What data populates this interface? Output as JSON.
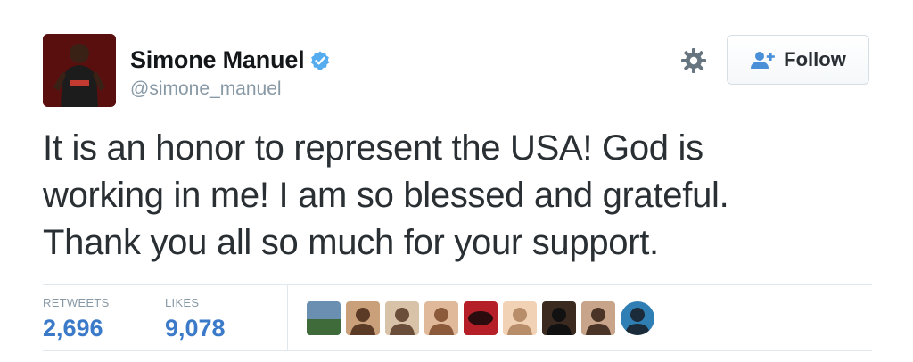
{
  "user": {
    "name": "Simone Manuel",
    "handle": "@simone_manuel"
  },
  "follow_button": {
    "label": "Follow"
  },
  "tweet": {
    "text": "It is an honor to represent the USA! God is\nworking in me! I am so blessed and grateful.\nThank you all so much for your support."
  },
  "stats": {
    "retweets_label": "RETWEETS",
    "retweets_value": "2,696",
    "likes_label": "LIKES",
    "likes_value": "9,078"
  },
  "likers": [
    {
      "icon": "landscape-avatar",
      "colors": [
        "#6a8fb0",
        "#3f6b3a"
      ]
    },
    {
      "icon": "person-avatar",
      "colors": [
        "#c9a07a",
        "#5b3a26"
      ]
    },
    {
      "icon": "person-avatar",
      "colors": [
        "#d8c2a8",
        "#6b4e3a"
      ]
    },
    {
      "icon": "person-avatar",
      "colors": [
        "#e0b99a",
        "#8a5a3b"
      ]
    },
    {
      "icon": "logo-avatar",
      "colors": [
        "#b41f28",
        "#2b0c0e"
      ]
    },
    {
      "icon": "person-avatar",
      "colors": [
        "#f1d2b5",
        "#b88d6a"
      ]
    },
    {
      "icon": "person-avatar",
      "colors": [
        "#3b2a20",
        "#111111"
      ]
    },
    {
      "icon": "person-avatar",
      "colors": [
        "#c8a48a",
        "#4a3428"
      ]
    },
    {
      "icon": "person-avatar",
      "colors": [
        "#2f7fb4",
        "#1c2b3a"
      ]
    }
  ],
  "colors": {
    "verified": "#55acee",
    "link_blue": "#3b7ac9",
    "muted": "#8899a6"
  }
}
